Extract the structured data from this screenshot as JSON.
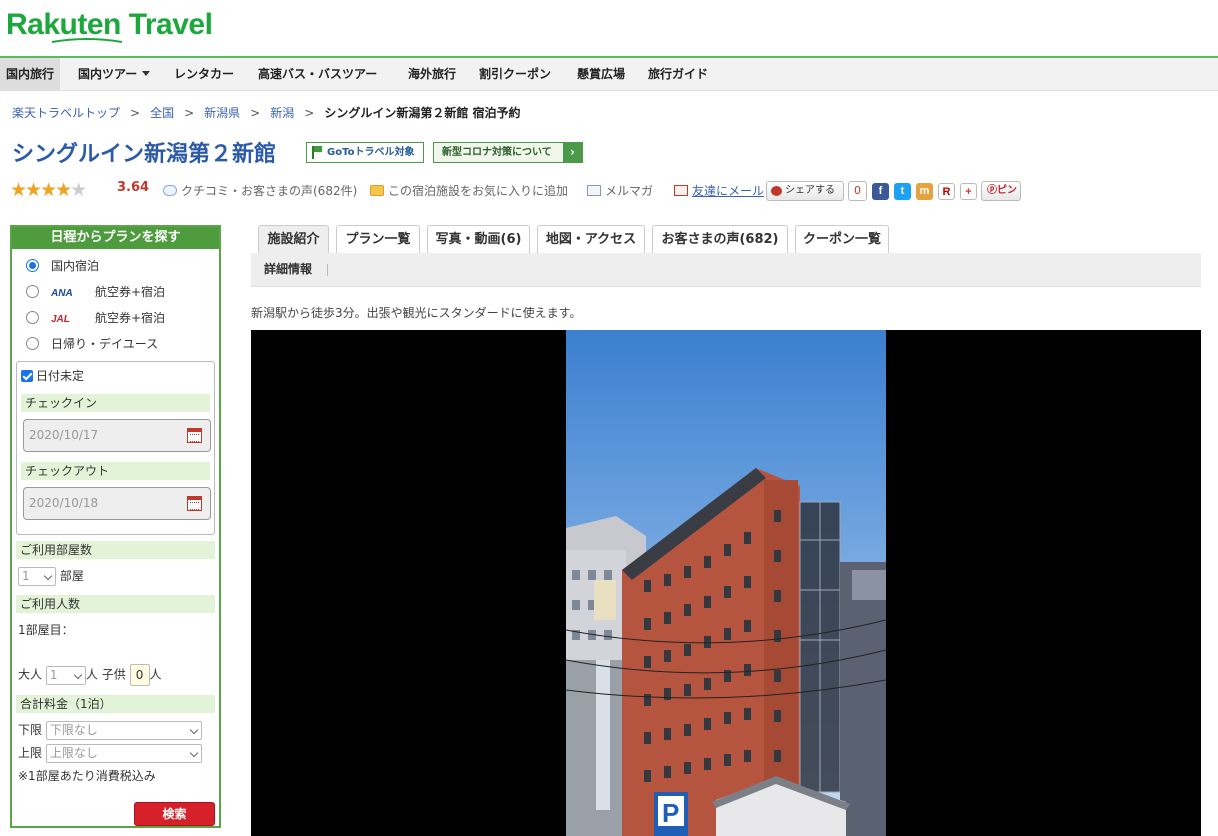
{
  "brand": {
    "logo_text": "Rakuten Travel",
    "accent": "#1ca83c"
  },
  "nav": {
    "items": [
      {
        "label": "国内旅行",
        "active": true
      },
      {
        "label": "国内ツアー",
        "dropdown": true
      },
      {
        "label": "レンタカー"
      },
      {
        "label": "高速バス・バスツアー"
      },
      {
        "label": "海外旅行"
      },
      {
        "label": "割引クーポン"
      },
      {
        "label": "懸賞広場"
      },
      {
        "label": "旅行ガイド"
      }
    ]
  },
  "breadcrumb": {
    "items": [
      "楽天トラベルトップ",
      "全国",
      "新潟県",
      "新潟"
    ],
    "current": "シングルイン新潟第２新館 宿泊予約",
    "separator": ">"
  },
  "hotel": {
    "name": "シングルイン新潟第２新館",
    "goto_badge": "GoToトラベル対象",
    "corona_badge": "新型コロナ対策について",
    "rating": 3.64,
    "rating_text": "3.64",
    "stars_filled": "★★★★",
    "stars_empty": "★",
    "reviews_link": "クチコミ・お客さまの声(682件)",
    "favorite_link": "この宿泊施設をお気に入りに追加",
    "mailmag_link": "メルマガ",
    "mail_friend_link": "友達にメール",
    "share_label": "シェアする",
    "share_count": "0",
    "pin_label": "ピン"
  },
  "sidebar": {
    "title": "日程からプランを探す",
    "options": [
      {
        "label": "国内宿泊",
        "selected": true
      },
      {
        "logo": "ANA",
        "label": "航空券+宿泊"
      },
      {
        "logo": "JAL",
        "label": "航空券+宿泊"
      },
      {
        "label": "日帰り・デイユース"
      }
    ],
    "date_undecided": "日付未定",
    "checkin_label": "チェックイン",
    "checkin_value": "2020/10/17",
    "checkout_label": "チェックアウト",
    "checkout_value": "2020/10/18",
    "rooms_label": "ご利用部屋数",
    "rooms_value": "1",
    "rooms_unit": "部屋",
    "guests_label": "ご利用人数",
    "room1_label": "1部屋目：",
    "adult_label": "大人",
    "adult_value": "1",
    "person_unit": "人",
    "child_label": "子供",
    "child_value": "0",
    "price_label": "合計料金（1泊）",
    "min_label": "下限",
    "min_value": "下限なし",
    "max_label": "上限",
    "max_value": "上限なし",
    "tax_note": "※1部屋あたり消費税込み",
    "search_button": "検索"
  },
  "tabs": [
    {
      "label": "施設紹介",
      "active": true
    },
    {
      "label": "プラン一覧"
    },
    {
      "label": "写真・動画(6)"
    },
    {
      "label": "地図・アクセス"
    },
    {
      "label": "お客さまの声(682)"
    },
    {
      "label": "クーポン一覧"
    }
  ],
  "subnav": {
    "item": "詳細情報"
  },
  "intro": "新潟駅から徒歩3分。出張や観光にスタンダードに使えます。"
}
